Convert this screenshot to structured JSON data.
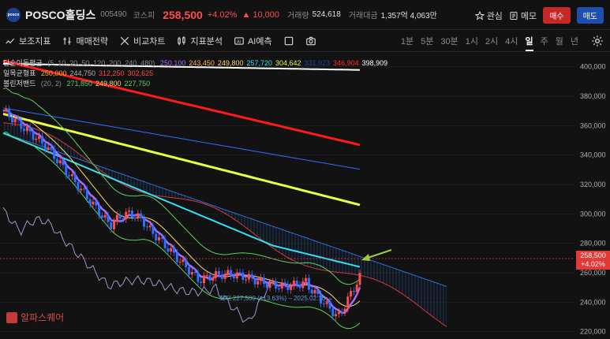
{
  "header": {
    "name": "POSCO홀딩스",
    "code": "005490",
    "market": "코스피",
    "price": "258,500",
    "change_pct": "+4.02%",
    "change_amt": "▲ 10,000",
    "volume_label": "거래량",
    "volume": "524,618",
    "amount_label": "거래대금",
    "amount": "1,357억 4,063만",
    "watch_label": "관심",
    "memo_label": "메모",
    "buy_label": "매수",
    "sell_label": "매도",
    "logo_text": "posco"
  },
  "toolbar": {
    "aux_label": "보조지표",
    "strategy_label": "매매전략",
    "compare_label": "비교차트",
    "analysis_label": "지표분석",
    "ai_label": "AI예측",
    "timeframes": [
      "1분",
      "5분",
      "30분",
      "1시",
      "2시",
      "4시",
      "일",
      "주",
      "월",
      "년"
    ],
    "active_timeframe": "일"
  },
  "legends": {
    "ma": {
      "title": "단순이동평균",
      "params": "(5, 10, 20, 50, 120, 200, 240, 480)",
      "values": [
        "250,100",
        "243,450",
        "249,800",
        "257,720",
        "304,642",
        "331,923",
        "346,904",
        "398,909"
      ],
      "colors": [
        "#a86bff",
        "#ffb347",
        "#ffd966",
        "#33e0f5",
        "#e8ff3d",
        "#2a3fa8",
        "#ff2a2a",
        "#ffffff"
      ]
    },
    "ichimoku": {
      "title": "일목균형표",
      "values": [
        "250,000",
        "244,750",
        "312,250",
        "302,625"
      ],
      "colors": [
        "#e8b63a",
        "#b0b0b0",
        "#ff4d4d",
        "#ff4d4d"
      ]
    },
    "bollinger": {
      "title": "볼린저밴드",
      "params": "(20, 2)",
      "values": [
        "271,850",
        "249,800",
        "227,750"
      ],
      "colors": [
        "#5fd15f",
        "#ffd966",
        "#5fd15f"
      ]
    }
  },
  "annotation": {
    "low_note": "최저 227,500 (+13.63%) – 2025.02.10 →",
    "price_tag_price": "258,500",
    "price_tag_pct": "+4.02%"
  },
  "watermark": "알파스퀘어",
  "colors": {
    "up": "#ff4d4d",
    "down": "#2f6fff",
    "ma200": "#ff1a1a",
    "ma120": "#e8ff3d",
    "ma480": "#ffffff",
    "ma50": "#33e0f5",
    "cloud_edge_blue": "#2e6fd6",
    "cloud_edge_red": "#d23a3a"
  },
  "chart_data": {
    "type": "line",
    "y_axis_ticks": [
      "400,000",
      "380,000",
      "360,000",
      "340,000",
      "320,000",
      "300,000",
      "280,000",
      "260,000",
      "240,000",
      "220,000"
    ],
    "ylim": [
      215000,
      410000
    ],
    "scale_note": "candlestick daily chart with moving averages, ichimoku cloud and bollinger bands"
  }
}
